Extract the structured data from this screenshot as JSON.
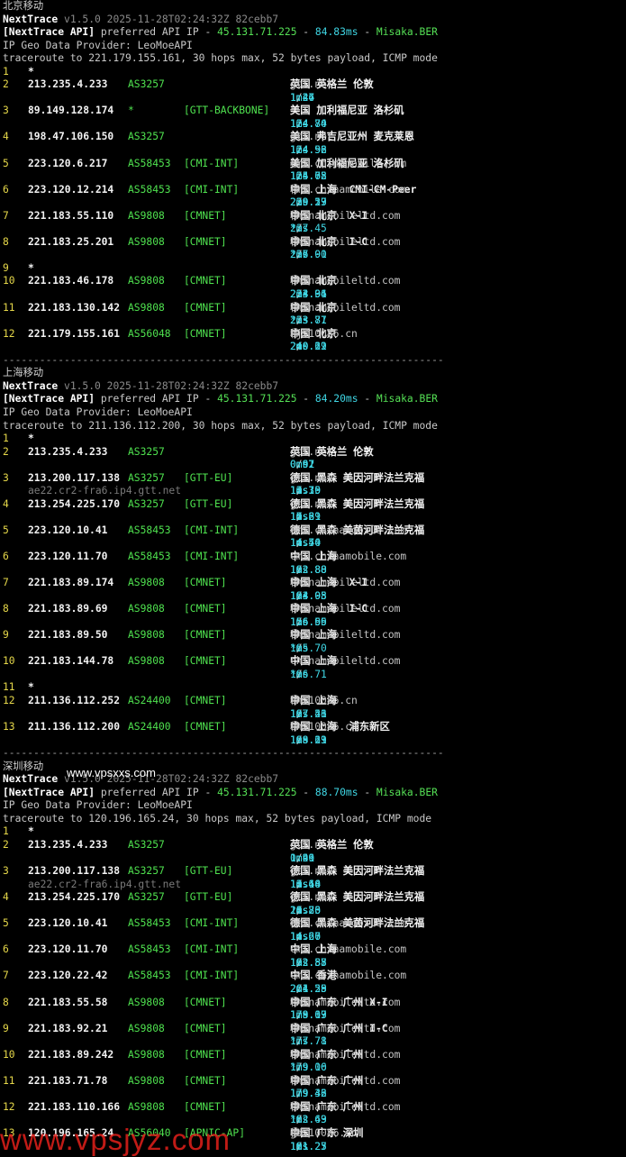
{
  "colors": {
    "hop": "#e6d84a",
    "ip": "#f2f2f2",
    "asn": "#4fe24f",
    "rtt": "#3fd6e4",
    "domain": "#c4c4c4",
    "host": "#7a7a7a",
    "watermark": "#e3201b"
  },
  "watermarks": {
    "inline": "www.vpsxxs.com",
    "bottom": "www.vpsjyz.com"
  },
  "divider": "------------------------------------------------------------------------",
  "sections": [
    {
      "title": "北京移动",
      "app": "NextTrace",
      "version": "v1.5.0 2025-11-28T02:24:32Z 82cebb7",
      "api_label": "[NextTrace API]",
      "api_text": "preferred API IP - ",
      "api_ip": "45.131.71.225",
      "api_latency": "84.83ms",
      "api_node": "Misaka.BER",
      "geo_provider": "IP Geo Data Provider: LeoMoeAPI",
      "traceroute": "traceroute to 221.179.155.161, 30 hops max, 52 bytes payload, ICMP mode",
      "hops": [
        {
          "n": "1",
          "ip": "*"
        },
        {
          "n": "2",
          "ip": "213.235.4.233",
          "as": "AS3257",
          "tag": "",
          "geo": "英国 英格兰 伦敦",
          "domain": "gtt.net",
          "isp": "",
          "rtt": [
            "1.46",
            "1.27",
            "1.24"
          ]
        },
        {
          "n": "3",
          "ip": "89.149.128.174",
          "as": "*",
          "tag": "[GTT-BACKBONE]",
          "geo": "美国 加利福尼亚 洛杉矶",
          "domain": "",
          "isp": "",
          "rtt": [
            "124.70",
            "124.74",
            "124.84"
          ]
        },
        {
          "n": "4",
          "ip": "198.47.106.150",
          "as": "AS3257",
          "tag": "",
          "geo": "美国 弗吉尼亚州 麦克莱恩",
          "domain": "gtt.net",
          "isp": "",
          "rtt": [
            "124.56",
            "124.92",
            "124.98"
          ]
        },
        {
          "n": "5",
          "ip": "223.120.6.217",
          "as": "AS58453",
          "tag": "[CMI-INT]",
          "geo": "美国 加利福尼亚 洛杉矶",
          "domain": "cmi.chinamobile.com",
          "isp": "移动",
          "rtt": [
            "124.78",
            "125.05",
            "124.62"
          ]
        },
        {
          "n": "6",
          "ip": "223.120.12.214",
          "as": "AS58453",
          "tag": "[CMI-INT]",
          "geo": "中国 上海  CMI-CM-Peer",
          "domain": "cmi.chinamobile.com",
          "isp": "移动",
          "rtt": [
            "229.13",
            "229.57",
            "230.29"
          ]
        },
        {
          "n": "7",
          "ip": "221.183.55.110",
          "as": "AS9808",
          "tag": "[CMNET]",
          "geo": "中国 北京  X-I",
          "domain": "chinamobileltd.com",
          "isp": "移动",
          "rtt": [
            "237.45",
            "*",
            "*"
          ]
        },
        {
          "n": "8",
          "ip": "221.183.25.201",
          "as": "AS9808",
          "tag": "[CMNET]",
          "geo": "中国 北京  I-C",
          "domain": "chinamobileltd.com",
          "isp": "移动",
          "rtt": [
            "236.00",
            "237.91",
            "*"
          ]
        },
        {
          "n": "9",
          "ip": "*"
        },
        {
          "n": "10",
          "ip": "221.183.46.178",
          "as": "AS9808",
          "tag": "[CMNET]",
          "geo": "中国 北京",
          "domain": "chinamobileltd.com",
          "isp": "移动",
          "rtt": [
            "233.36",
            "234.01",
            "233.94"
          ]
        },
        {
          "n": "11",
          "ip": "221.183.130.142",
          "as": "AS9808",
          "tag": "[CMNET]",
          "geo": "中国 北京",
          "domain": "chinamobileltd.com",
          "isp": "移动",
          "rtt": [
            "233.71",
            "233.87",
            "*"
          ]
        },
        {
          "n": "12",
          "ip": "221.179.155.161",
          "as": "AS56048",
          "tag": "[CMNET]",
          "geo": "中国 北京",
          "domain": "bj.10086.cn",
          "isp": "移动",
          "rtt": [
            "240.61",
            "240.19",
            "240.22"
          ]
        }
      ]
    },
    {
      "title": "上海移动",
      "app": "NextTrace",
      "version": "v1.5.0 2025-11-28T02:24:32Z 82cebb7",
      "api_label": "[NextTrace API]",
      "api_text": "preferred API IP - ",
      "api_ip": "45.131.71.225",
      "api_latency": "84.20ms",
      "api_node": "Misaka.BER",
      "geo_provider": "IP Geo Data Provider: LeoMoeAPI",
      "traceroute": "traceroute to 211.136.112.200, 30 hops max, 52 bytes payload, ICMP mode",
      "hops": [
        {
          "n": "1",
          "ip": "*"
        },
        {
          "n": "2",
          "ip": "213.235.4.233",
          "as": "AS3257",
          "tag": "",
          "geo": "英国 英格兰 伦敦",
          "domain": "gtt.net",
          "isp": "",
          "rtt": [
            "0.91",
            "0.62",
            "0.97"
          ]
        },
        {
          "n": "3",
          "ip": "213.200.117.138",
          "as": "AS3257",
          "tag": "[GTT-EU]",
          "geo": "德国 黑森 美因河畔法兰克福",
          "domain": "gtt.net",
          "isp": "",
          "host": "ae22.cr2-fra6.ip4.gtt.net",
          "rtt": [
            "13.39",
            "13.75",
            "14.10"
          ]
        },
        {
          "n": "4",
          "ip": "213.254.225.170",
          "as": "AS3257",
          "tag": "[GTT-EU]",
          "geo": "德国 黑森 美因河畔法兰克福",
          "domain": "gtt.net",
          "isp": "",
          "rtt": [
            "15.21",
            "14.61",
            "17.89"
          ]
        },
        {
          "n": "5",
          "ip": "223.120.10.41",
          "as": "AS58453",
          "tag": "[CMI-INT]",
          "geo": "德国 黑森 美茵河畔法兰克福",
          "domain": "cmi.chinamobile.com",
          "isp": "移动",
          "rtt": [
            "14.40",
            "14.74",
            "14.50"
          ]
        },
        {
          "n": "6",
          "ip": "223.120.11.70",
          "as": "AS58453",
          "tag": "[CMI-INT]",
          "geo": "中国 上海",
          "domain": "cmi.chinamobile.com",
          "isp": "",
          "rtt": [
            "192.80",
            "192.88",
            "192.88"
          ]
        },
        {
          "n": "7",
          "ip": "221.183.89.174",
          "as": "AS9808",
          "tag": "[CMNET]",
          "geo": "中国 上海  X-I",
          "domain": "chinamobileltd.com",
          "isp": "移动",
          "rtt": [
            "193.95",
            "194.08",
            "194.03"
          ]
        },
        {
          "n": "8",
          "ip": "221.183.89.69",
          "as": "AS9808",
          "tag": "[CMNET]",
          "geo": "中国 上海  I-C",
          "domain": "chinamobileltd.com",
          "isp": "移动",
          "rtt": [
            "156.95",
            "156.69",
            "156.56"
          ]
        },
        {
          "n": "9",
          "ip": "221.183.89.50",
          "as": "AS9808",
          "tag": "[CMNET]",
          "geo": "中国 上海",
          "domain": "chinamobileltd.com",
          "isp": "移动",
          "rtt": [
            "195.70",
            "*",
            "*"
          ]
        },
        {
          "n": "10",
          "ip": "221.183.144.78",
          "as": "AS9808",
          "tag": "[CMNET]",
          "geo": "中国 上海",
          "domain": "chinamobileltd.com",
          "isp": "",
          "rtt": [
            "196.71",
            "*",
            "*"
          ]
        },
        {
          "n": "11",
          "ip": "*"
        },
        {
          "n": "12",
          "ip": "211.136.112.252",
          "as": "AS24400",
          "tag": "[CMNET]",
          "geo": "中国 上海",
          "domain": "sh.10086.cn",
          "isp": "移动",
          "rtt": [
            "197.26",
            "197.51",
            "197.43"
          ]
        },
        {
          "n": "13",
          "ip": "211.136.112.200",
          "as": "AS24400",
          "tag": "[CMNET]",
          "geo": "中国 上海  浦东新区",
          "domain": "sh.10086.cn",
          "isp": "移动",
          "rtt": [
            "198.61",
            "198.29",
            "199.13"
          ]
        }
      ]
    },
    {
      "title": "深圳移动",
      "app": "NextTrace",
      "version": "v1.5.0 2025-11-28T02:24:32Z 82cebb7",
      "api_label": "[NextTrace API]",
      "api_text": "preferred API IP - ",
      "api_ip": "45.131.71.225",
      "api_latency": "88.70ms",
      "api_node": "Misaka.BER",
      "geo_provider": "IP Geo Data Provider: LeoMoeAPI",
      "traceroute": "traceroute to 120.196.165.24, 30 hops max, 52 bytes payload, ICMP mode",
      "hops": [
        {
          "n": "1",
          "ip": "*"
        },
        {
          "n": "2",
          "ip": "213.235.4.233",
          "as": "AS3257",
          "tag": "",
          "geo": "英国 英格兰 伦敦",
          "domain": "gtt.net",
          "isp": "",
          "rtt": [
            "1.21",
            "0.96",
            "1.49"
          ]
        },
        {
          "n": "3",
          "ip": "213.200.117.138",
          "as": "AS3257",
          "tag": "[GTT-EU]",
          "geo": "德国 黑森 美因河畔法兰克福",
          "domain": "gtt.net",
          "isp": "",
          "host": "ae22.cr2-fra6.ip4.gtt.net",
          "rtt": [
            "13.48",
            "13.60",
            "14.14"
          ]
        },
        {
          "n": "4",
          "ip": "213.254.225.170",
          "as": "AS3257",
          "tag": "[GTT-EU]",
          "geo": "德国 黑森 美因河畔法兰克福",
          "domain": "gtt.net",
          "isp": "",
          "rtt": [
            "23.80",
            "26.73",
            "14.26"
          ]
        },
        {
          "n": "5",
          "ip": "223.120.10.41",
          "as": "AS58453",
          "tag": "[CMI-INT]",
          "geo": "德国 黑森 美茵河畔法兰克福",
          "domain": "cmi.chinamobile.com",
          "isp": "移动",
          "rtt": [
            "14.67",
            "14.20",
            "14.66"
          ]
        },
        {
          "n": "6",
          "ip": "223.120.11.70",
          "as": "AS58453",
          "tag": "[CMI-INT]",
          "geo": "中国 上海",
          "domain": "cmi.chinamobile.com",
          "isp": "",
          "rtt": [
            "192.85",
            "192.88",
            "192.57"
          ]
        },
        {
          "n": "7",
          "ip": "223.120.22.42",
          "as": "AS58453",
          "tag": "[CMI-INT]",
          "geo": "中国 香港",
          "domain": "cmi.chinamobile.com",
          "isp": "",
          "rtt": [
            "201.29",
            "204.58",
            "201.25"
          ]
        },
        {
          "n": "8",
          "ip": "221.183.55.58",
          "as": "AS9808",
          "tag": "[CMNET]",
          "geo": "中国 广东 广州 X-I",
          "domain": "chinamobileltd.com",
          "isp": "移动",
          "rtt": [
            "178.67",
            "179.03",
            "179.19"
          ]
        },
        {
          "n": "9",
          "ip": "221.183.92.21",
          "as": "AS9808",
          "tag": "[CMNET]",
          "geo": "中国 广东 广州 I-C",
          "domain": "chinamobileltd.com",
          "isp": "移动",
          "rtt": [
            "177.78",
            "177.71",
            "*"
          ]
        },
        {
          "n": "10",
          "ip": "221.183.89.242",
          "as": "AS9808",
          "tag": "[CMNET]",
          "geo": "中国 广东 广州",
          "domain": "chinamobileltd.com",
          "isp": "移动",
          "rtt": [
            "179.06",
            "179.10",
            "*"
          ]
        },
        {
          "n": "11",
          "ip": "221.183.71.78",
          "as": "AS9808",
          "tag": "[CMNET]",
          "geo": "中国 广东 广州",
          "domain": "chinamobileltd.com",
          "isp": "移动",
          "rtt": [
            "179.36",
            "179.43",
            "179.42"
          ]
        },
        {
          "n": "12",
          "ip": "221.183.110.166",
          "as": "AS9808",
          "tag": "[CMNET]",
          "geo": "中国 广东 广州",
          "domain": "chinamobileltd.com",
          "isp": "移动",
          "rtt": [
            "182.49",
            "182.63",
            "*"
          ]
        },
        {
          "n": "13",
          "ip": "120.196.165.24",
          "as": "AS56040",
          "tag": "[APNIC-AP]",
          "geo": "中国 广东 深圳",
          "domain": "gd.10086.cn",
          "isp": "移动",
          "rtt": [
            "181.23",
            "181.27",
            "181.25"
          ]
        }
      ]
    }
  ]
}
